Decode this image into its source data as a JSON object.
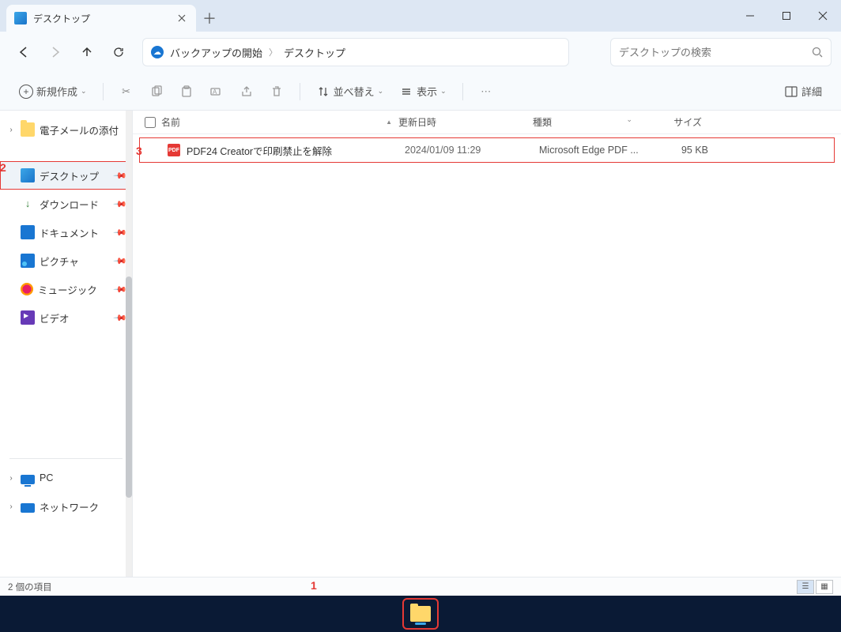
{
  "colors": {
    "accent": "#1976d2",
    "highlight": "#e53935"
  },
  "annotations": {
    "one": "1",
    "two": "2",
    "three": "3"
  },
  "titlebar": {
    "tab_label": "デスクトップ"
  },
  "navbar": {
    "address": {
      "backup_start": "バックアップの開始",
      "current": "デスクトップ"
    },
    "search_placeholder": "デスクトップの検索"
  },
  "toolbar": {
    "new": "新規作成",
    "sort": "並べ替え",
    "view": "表示",
    "details": "詳細"
  },
  "sidebar": {
    "items": [
      "電子メールの添付",
      "デスクトップ",
      "ダウンロード",
      "ドキュメント",
      "ピクチャ",
      "ミュージック",
      "ビデオ",
      "PC",
      "ネットワーク"
    ]
  },
  "columns": {
    "name": "名前",
    "date": "更新日時",
    "type": "種類",
    "size": "サイズ"
  },
  "files": [
    {
      "name": "PDF24 Creatorで印刷禁止を解除",
      "date": "2024/01/09 11:29",
      "type": "Microsoft Edge PDF ...",
      "size": "95 KB"
    }
  ],
  "statusbar": {
    "count": "2 個の項目"
  }
}
